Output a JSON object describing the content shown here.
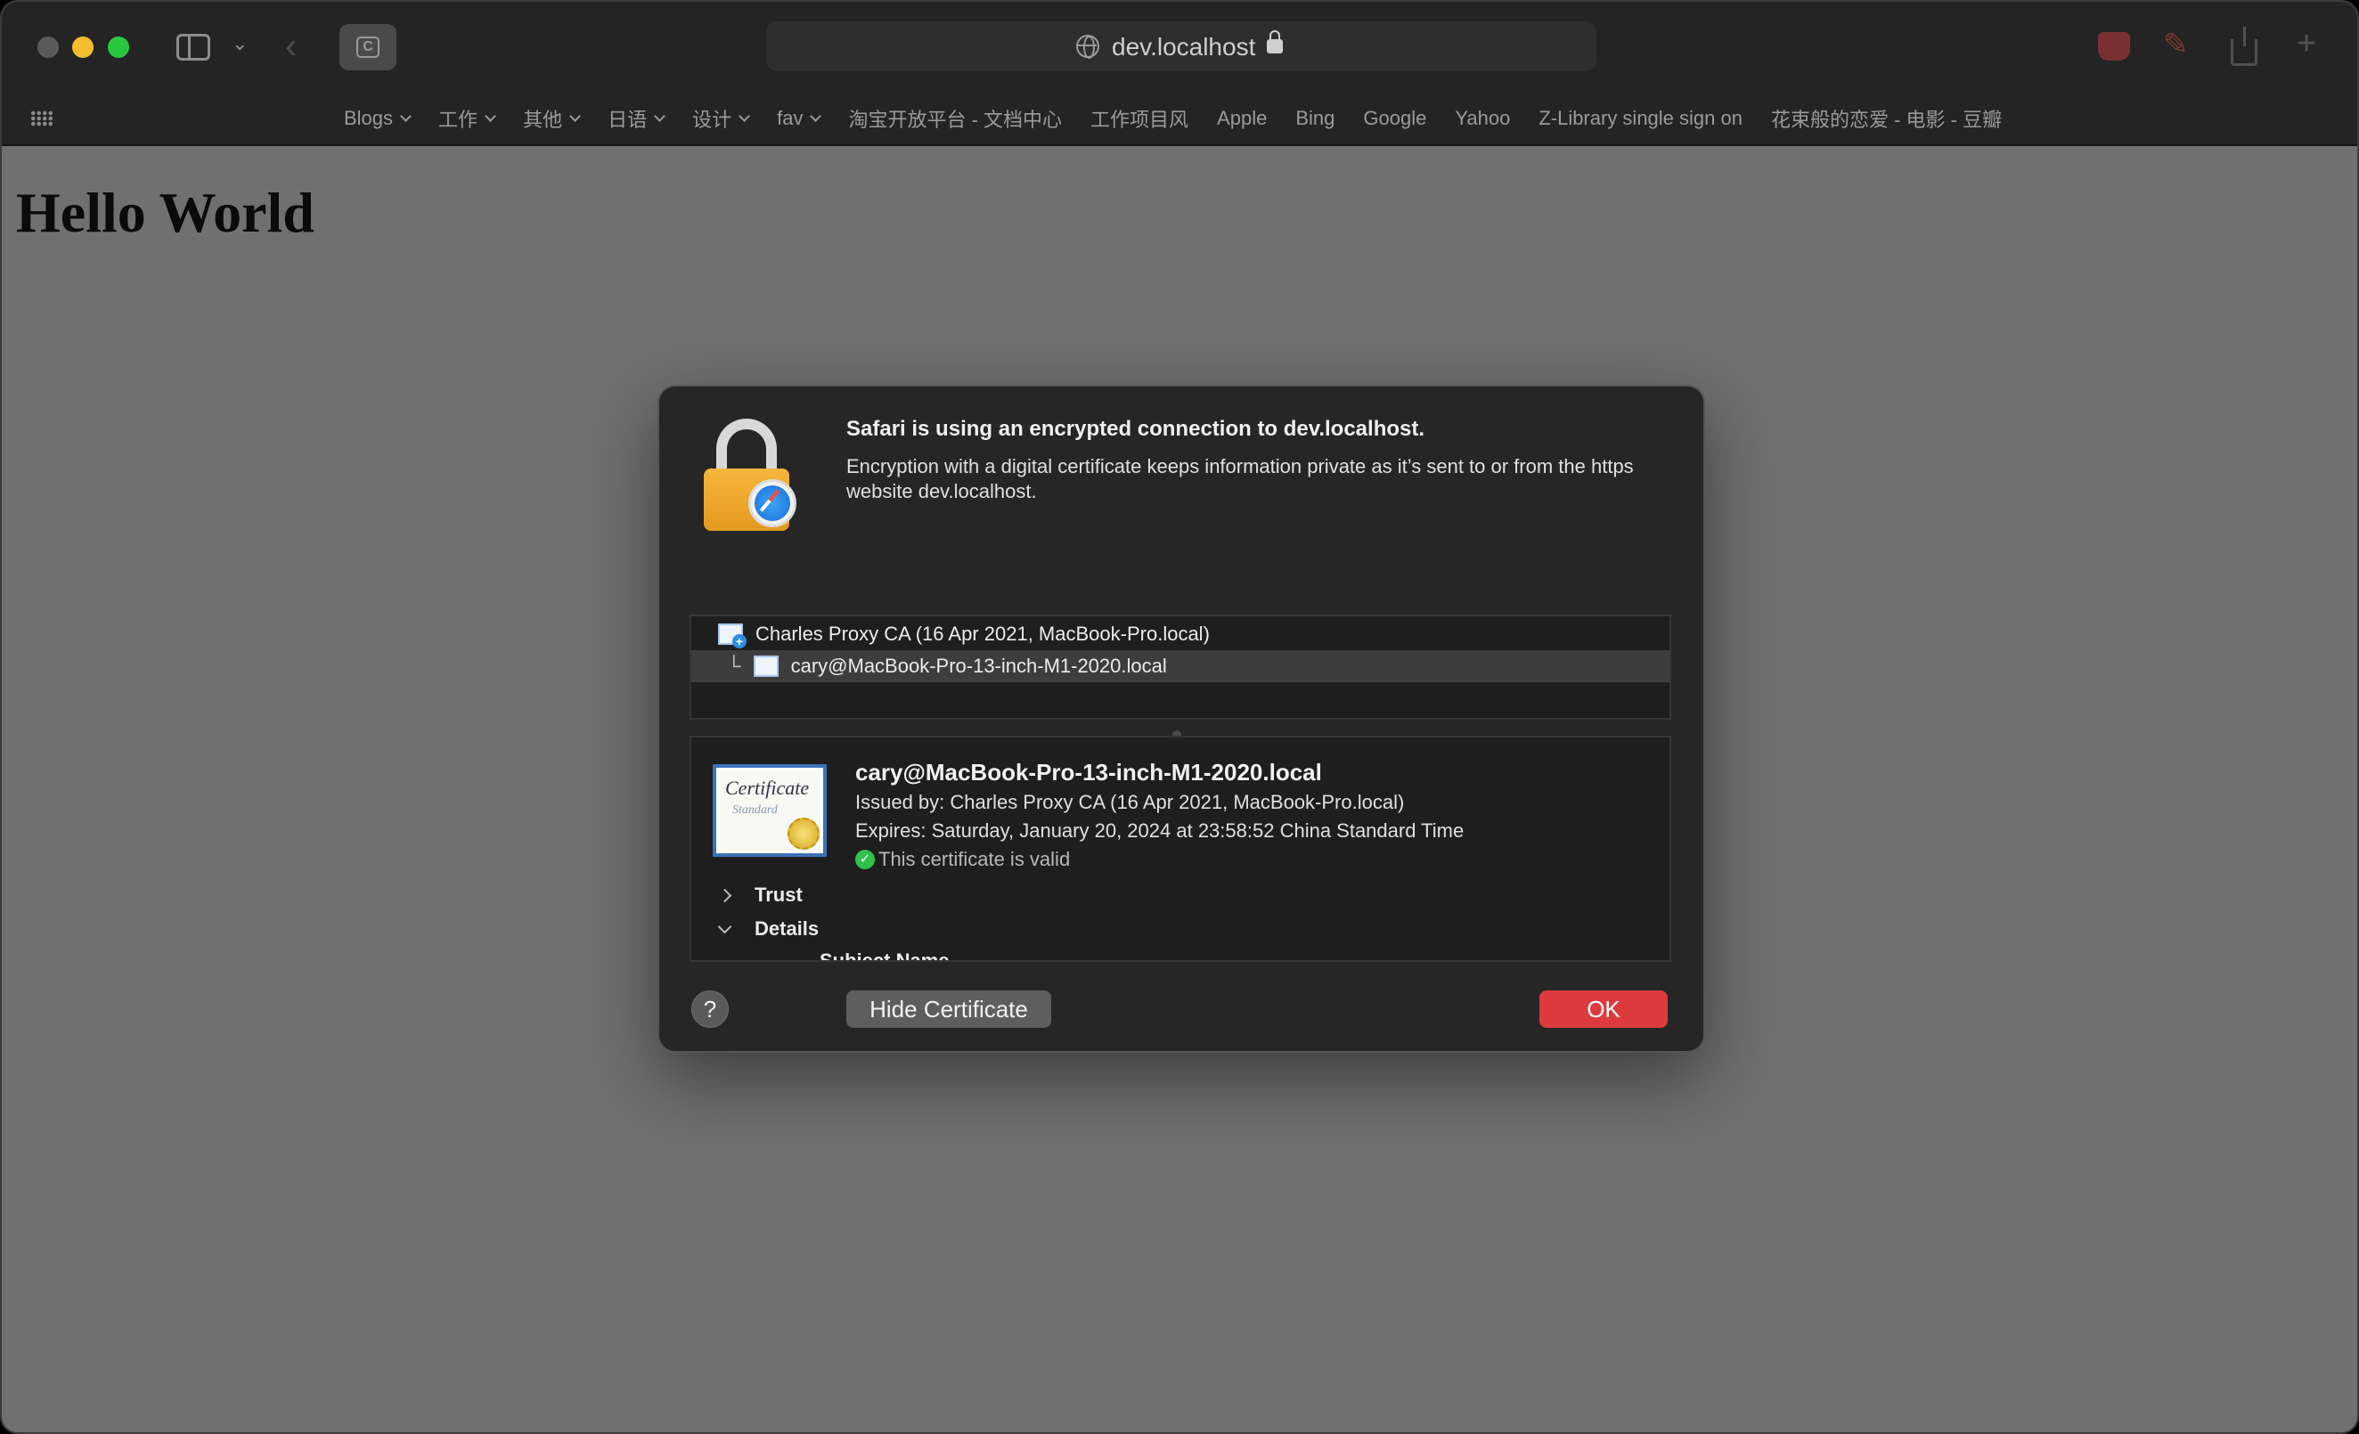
{
  "browser": {
    "address": "dev.localhost"
  },
  "bookmarks": [
    {
      "label": "Blogs",
      "folder": true
    },
    {
      "label": "工作",
      "folder": true
    },
    {
      "label": "其他",
      "folder": true
    },
    {
      "label": "日语",
      "folder": true
    },
    {
      "label": "设计",
      "folder": true
    },
    {
      "label": "fav",
      "folder": true
    },
    {
      "label": "淘宝开放平台 - 文档中心",
      "folder": false
    },
    {
      "label": "工作项目风",
      "folder": false
    },
    {
      "label": "Apple",
      "folder": false
    },
    {
      "label": "Bing",
      "folder": false
    },
    {
      "label": "Google",
      "folder": false
    },
    {
      "label": "Yahoo",
      "folder": false
    },
    {
      "label": "Z-Library single sign on",
      "folder": false
    },
    {
      "label": "花束般的恋爱 - 电影 - 豆瓣",
      "folder": false
    }
  ],
  "page": {
    "heading": "Hello World"
  },
  "dialog": {
    "title": "Safari is using an encrypted connection to dev.localhost.",
    "description": "Encryption with a digital certificate keeps information private as it’s sent to or from the https website dev.localhost.",
    "chain": [
      {
        "label": "Charles Proxy CA (16 Apr 2021, MacBook-Pro.local)"
      },
      {
        "label": "cary@MacBook-Pro-13-inch-M1-2020.local"
      }
    ],
    "cert": {
      "image_title": "Certificate",
      "image_subtitle": "Standard",
      "name": "cary@MacBook-Pro-13-inch-M1-2020.local",
      "issued_by": "Issued by: Charles Proxy CA (16 Apr 2021, MacBook-Pro.local)",
      "expires": "Expires: Saturday, January 20, 2024 at 23:58:52 China Standard Time",
      "valid": "This certificate is valid",
      "trust_label": "Trust",
      "details_label": "Details",
      "subject_name_label": "Subject Name"
    },
    "help_label": "?",
    "hide_certificate_label": "Hide Certificate",
    "ok_label": "OK"
  },
  "colors": {
    "ok_button": "#dd3a3d",
    "valid_check": "#2fc24a"
  }
}
